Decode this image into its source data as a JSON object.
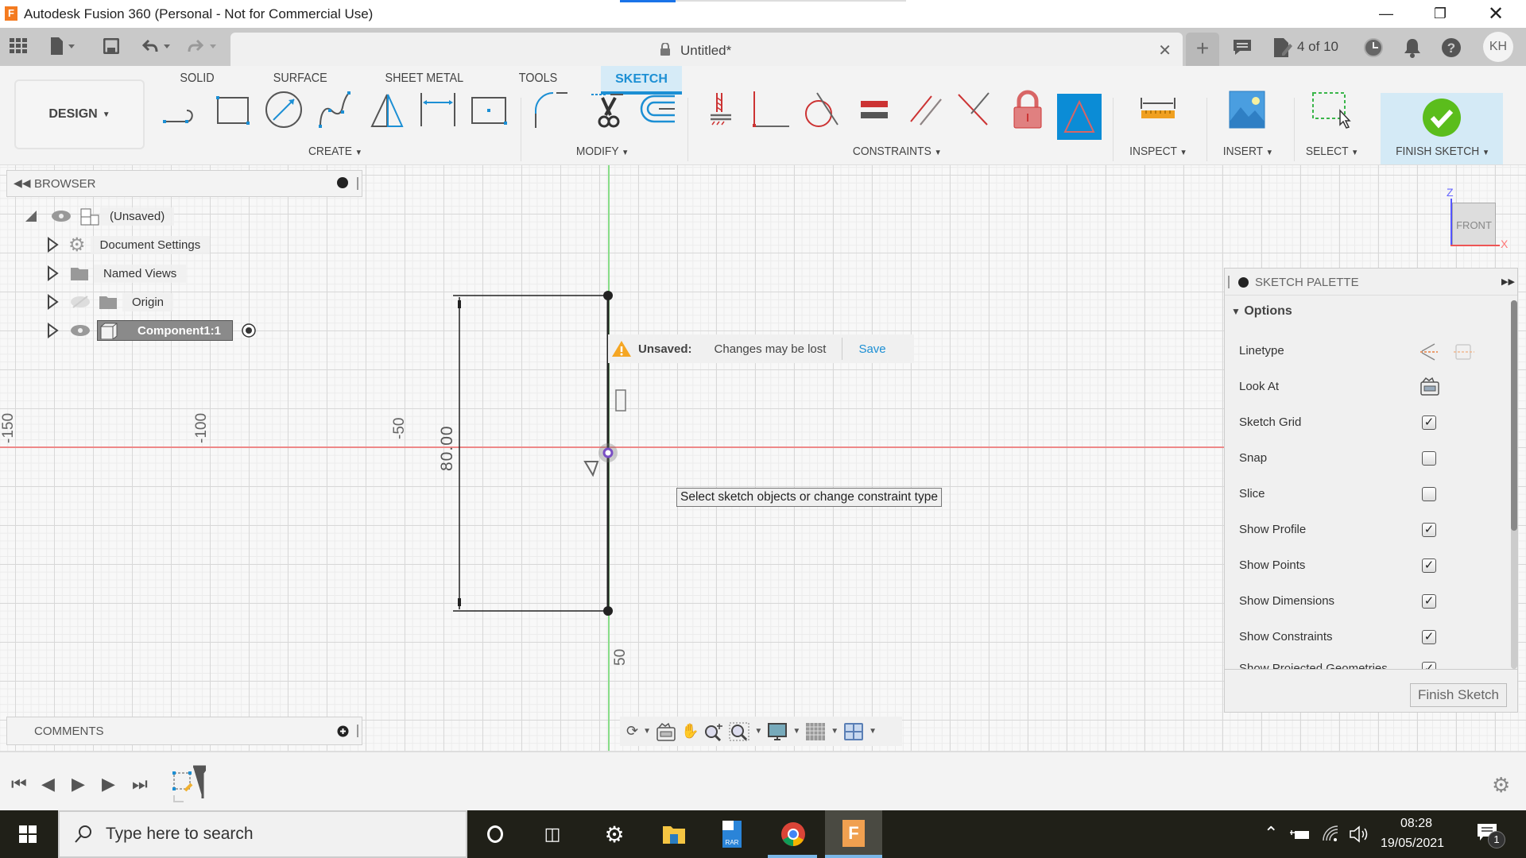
{
  "window": {
    "title": "Autodesk Fusion 360 (Personal - Not for Commercial Use)",
    "minimize_icon": "minimize-icon",
    "maximize_icon": "restore-icon",
    "close_icon": "close-icon"
  },
  "tabbar": {
    "document_name": "Untitled*",
    "jobs_status": "4 of 10",
    "user_initials": "KH"
  },
  "toolbar": {
    "workspace": "DESIGN",
    "tabs": [
      "SOLID",
      "SURFACE",
      "SHEET METAL",
      "TOOLS",
      "SKETCH"
    ],
    "active_tab": "SKETCH",
    "groups": {
      "create": "CREATE",
      "modify": "MODIFY",
      "constraints": "CONSTRAINTS",
      "inspect": "INSPECT",
      "insert": "INSERT",
      "select": "SELECT",
      "finish": "FINISH SKETCH"
    }
  },
  "browser": {
    "title": "BROWSER",
    "items": [
      {
        "label": "(Unsaved)",
        "icon": "component-stack-icon"
      },
      {
        "label": "Document Settings",
        "icon": "gear-icon"
      },
      {
        "label": "Named Views",
        "icon": "folder-icon"
      },
      {
        "label": "Origin",
        "icon": "folder-icon"
      },
      {
        "label": "Component1:1",
        "icon": "cube-icon"
      }
    ]
  },
  "notice": {
    "label": "Unsaved:",
    "message": "Changes may be lost",
    "action": "Save"
  },
  "tooltip": "Select sketch objects or change constraint type",
  "sketch": {
    "dimension": "80.00",
    "axis_labels_x": [
      "-150",
      "-100",
      "-50"
    ],
    "axis_labels_y": [
      "50"
    ]
  },
  "viewcube": {
    "face": "FRONT",
    "axis_z": "Z",
    "axis_x": "X"
  },
  "palette": {
    "title": "SKETCH PALETTE",
    "section": "Options",
    "rows": [
      {
        "label": "Linetype",
        "type": "icons"
      },
      {
        "label": "Look At",
        "type": "icon"
      },
      {
        "label": "Sketch Grid",
        "checked": true
      },
      {
        "label": "Snap",
        "checked": false
      },
      {
        "label": "Slice",
        "checked": false
      },
      {
        "label": "Show Profile",
        "checked": true
      },
      {
        "label": "Show Points",
        "checked": true
      },
      {
        "label": "Show Dimensions",
        "checked": true
      },
      {
        "label": "Show Constraints",
        "checked": true
      },
      {
        "label": "Show Projected Geometries",
        "checked": true
      }
    ],
    "finish_button": "Finish Sketch"
  },
  "comments": {
    "title": "COMMENTS"
  },
  "taskbar": {
    "search_placeholder": "Type here to search",
    "time": "08:28",
    "date": "19/05/2021",
    "notification_count": "1"
  }
}
